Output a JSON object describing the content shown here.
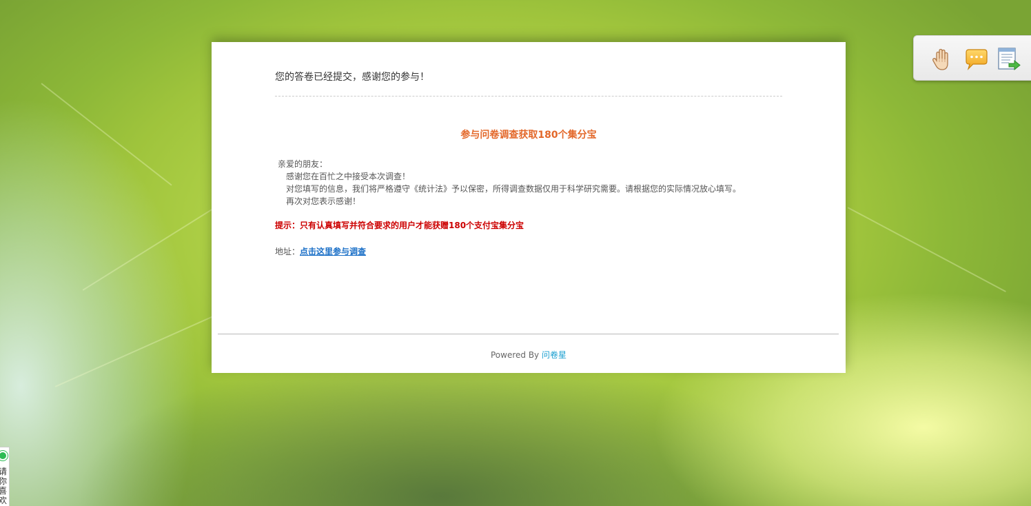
{
  "message": {
    "submitted": "您的答卷已经提交，感谢您的参与！"
  },
  "promo": {
    "title": "参与问卷调查获取180个集分宝",
    "greeting": "亲爱的朋友：",
    "lines": [
      "感谢您在百忙之中接受本次调查！",
      "对您填写的信息，我们将严格遵守《统计法》予以保密，所得调查数据仅用于科学研究需要。请根据您的实际情况放心填写。",
      "再次对您表示感谢！"
    ],
    "tip": "提示：只有认真填写并符合要求的用户才能获赠180个支付宝集分宝",
    "address_label": "地址：",
    "address_link": "点击这里参与调查"
  },
  "footer": {
    "powered_by": "Powered By",
    "brand": "问卷星"
  },
  "toolbar": {
    "icons": [
      "hand-icon",
      "chat-bubble-icon",
      "export-document-icon"
    ]
  },
  "side_widget": {
    "text": "请你喜欢"
  },
  "colors": {
    "promo_title": "#e3682a",
    "tip": "#cc0000",
    "link": "#1a6fc7",
    "brand": "#1a9fd0",
    "status_dot": "#2dbb55"
  }
}
